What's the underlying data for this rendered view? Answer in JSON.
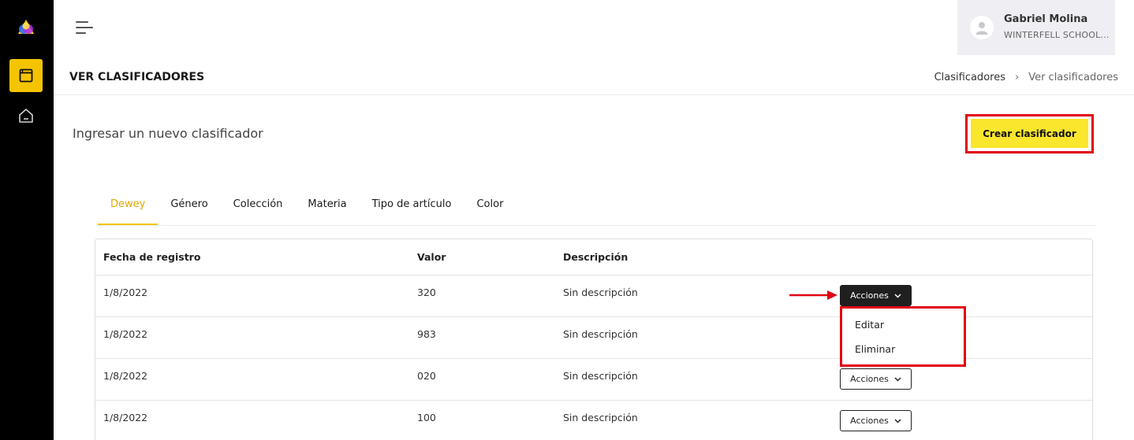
{
  "sidebar": {
    "items": [
      {
        "icon": "book-icon",
        "active": true
      },
      {
        "icon": "home-icon",
        "active": false
      }
    ]
  },
  "user": {
    "name": "Gabriel Molina",
    "school": "WINTERFELL SCHOOL..."
  },
  "header": {
    "title": "VER CLASIFICADORES",
    "breadcrumb": [
      "Clasificadores",
      "Ver clasificadores"
    ]
  },
  "main": {
    "section_title": "Ingresar un nuevo clasificador",
    "create_label": "Crear clasificador",
    "tabs": [
      {
        "label": "Dewey"
      },
      {
        "label": "Género"
      },
      {
        "label": "Colección"
      },
      {
        "label": "Materia"
      },
      {
        "label": "Tipo de artículo"
      },
      {
        "label": "Color"
      }
    ],
    "active_tab": "Dewey",
    "table": {
      "headers": [
        "Fecha de registro",
        "Valor",
        "Descripción"
      ],
      "rows": [
        {
          "fecha": "1/8/2022",
          "valor": "320",
          "descripcion": "Sin descripción",
          "action": "Acciones"
        },
        {
          "fecha": "1/8/2022",
          "valor": "983",
          "descripcion": "Sin descripción",
          "action": ""
        },
        {
          "fecha": "1/8/2022",
          "valor": "020",
          "descripcion": "Sin descripción",
          "action": "Acciones"
        },
        {
          "fecha": "1/8/2022",
          "valor": "100",
          "descripcion": "Sin descripción",
          "action": "Acciones"
        }
      ]
    },
    "dropdown": {
      "items": [
        "Editar",
        "Eliminar"
      ]
    }
  },
  "colors": {
    "accent_yellow": "#f5c400",
    "button_yellow": "#fae62d",
    "highlight_red": "#e00012",
    "sidebar_bg": "#000000"
  }
}
